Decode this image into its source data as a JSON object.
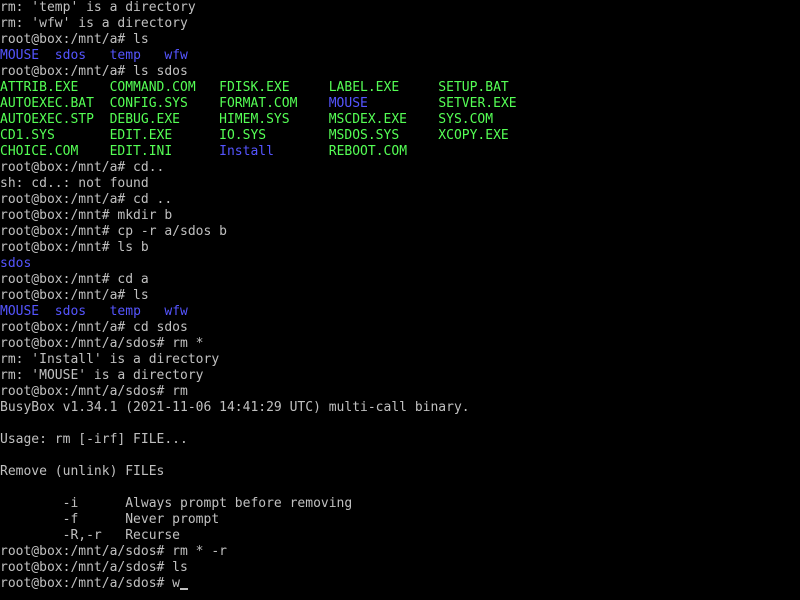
{
  "terminal": {
    "lines": [
      [
        {
          "t": "rm: 'temp' is a directory"
        }
      ],
      [
        {
          "t": "rm: 'wfw' is a directory"
        }
      ],
      [
        {
          "t": "root@box:/mnt/a# ls"
        }
      ],
      [
        {
          "t": "MOUSE",
          "c": "blue"
        },
        {
          "t": "  "
        },
        {
          "t": "sdos",
          "c": "blue"
        },
        {
          "t": "   "
        },
        {
          "t": "temp",
          "c": "blue"
        },
        {
          "t": "   "
        },
        {
          "t": "wfw",
          "c": "blue"
        }
      ],
      [
        {
          "t": "root@box:/mnt/a# ls sdos"
        }
      ],
      [
        {
          "t": "ATTRIB.EXE    COMMAND.COM   FDISK.EXE     LABEL.EXE     SETUP.BAT",
          "c": "green"
        }
      ],
      [
        {
          "t": "AUTOEXEC.BAT  CONFIG.SYS    FORMAT.COM    ",
          "c": "green"
        },
        {
          "t": "MOUSE",
          "c": "blue"
        },
        {
          "t": "         "
        },
        {
          "t": "SETVER.EXE",
          "c": "green"
        }
      ],
      [
        {
          "t": "AUTOEXEC.STP  DEBUG.EXE     HIMEM.SYS     MSCDEX.EXE    SYS.COM",
          "c": "green"
        }
      ],
      [
        {
          "t": "CD1.SYS       EDIT.EXE      IO.SYS        MSDOS.SYS     XCOPY.EXE",
          "c": "green"
        }
      ],
      [
        {
          "t": "CHOICE.COM    EDIT.INI      ",
          "c": "green"
        },
        {
          "t": "Install",
          "c": "blue"
        },
        {
          "t": "       "
        },
        {
          "t": "REBOOT.COM",
          "c": "green"
        }
      ],
      [
        {
          "t": "root@box:/mnt/a# cd.."
        }
      ],
      [
        {
          "t": "sh: cd..: not found"
        }
      ],
      [
        {
          "t": "root@box:/mnt/a# cd .."
        }
      ],
      [
        {
          "t": "root@box:/mnt# mkdir b"
        }
      ],
      [
        {
          "t": "root@box:/mnt# cp -r a/sdos b"
        }
      ],
      [
        {
          "t": "root@box:/mnt# ls b"
        }
      ],
      [
        {
          "t": "sdos",
          "c": "blue"
        }
      ],
      [
        {
          "t": "root@box:/mnt# cd a"
        }
      ],
      [
        {
          "t": "root@box:/mnt/a# ls"
        }
      ],
      [
        {
          "t": "MOUSE",
          "c": "blue"
        },
        {
          "t": "  "
        },
        {
          "t": "sdos",
          "c": "blue"
        },
        {
          "t": "   "
        },
        {
          "t": "temp",
          "c": "blue"
        },
        {
          "t": "   "
        },
        {
          "t": "wfw",
          "c": "blue"
        }
      ],
      [
        {
          "t": "root@box:/mnt/a# cd sdos"
        }
      ],
      [
        {
          "t": "root@box:/mnt/a/sdos# rm *"
        }
      ],
      [
        {
          "t": "rm: 'Install' is a directory"
        }
      ],
      [
        {
          "t": "rm: 'MOUSE' is a directory"
        }
      ],
      [
        {
          "t": "root@box:/mnt/a/sdos# rm"
        }
      ],
      [
        {
          "t": "BusyBox v1.34.1 (2021-11-06 14:41:29 UTC) multi-call binary."
        }
      ],
      [
        {
          "t": ""
        }
      ],
      [
        {
          "t": "Usage: rm [-irf] FILE..."
        }
      ],
      [
        {
          "t": ""
        }
      ],
      [
        {
          "t": "Remove (unlink) FILEs"
        }
      ],
      [
        {
          "t": ""
        }
      ],
      [
        {
          "t": "        -i      Always prompt before removing"
        }
      ],
      [
        {
          "t": "        -f      Never prompt"
        }
      ],
      [
        {
          "t": "        -R,-r   Recurse"
        }
      ],
      [
        {
          "t": "root@box:/mnt/a/sdos# rm * -r"
        }
      ],
      [
        {
          "t": "root@box:/mnt/a/sdos# ls"
        }
      ],
      [
        {
          "t": "root@box:/mnt/a/sdos# w"
        }
      ]
    ],
    "cursor_line": 36,
    "colors": {
      "default_text": "#c0c0c0",
      "executable_green": "#55ff55",
      "directory_blue": "#5555ff",
      "background": "#000000"
    }
  }
}
